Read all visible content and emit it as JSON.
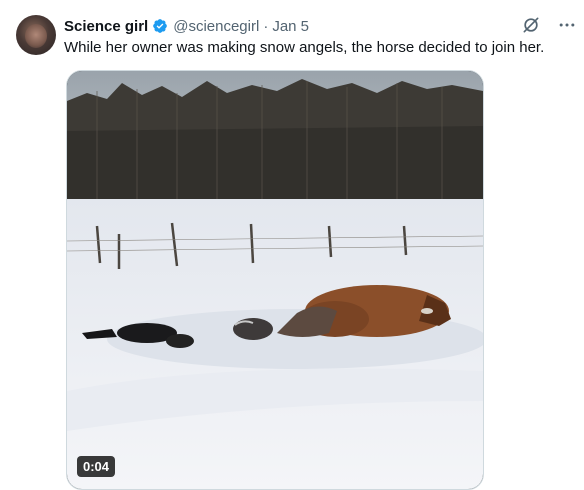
{
  "tweet": {
    "author_name": "Science girl",
    "handle": "@sciencegirl",
    "separator": "·",
    "date": "Jan 5",
    "text": "While her owner was making snow angels, the horse decided to join her.",
    "verified_color": "#1d9bf0"
  },
  "actions": {
    "grok_icon": "grok-icon",
    "more_icon": "more-icon"
  },
  "media": {
    "type": "video",
    "duration": "0:04"
  }
}
